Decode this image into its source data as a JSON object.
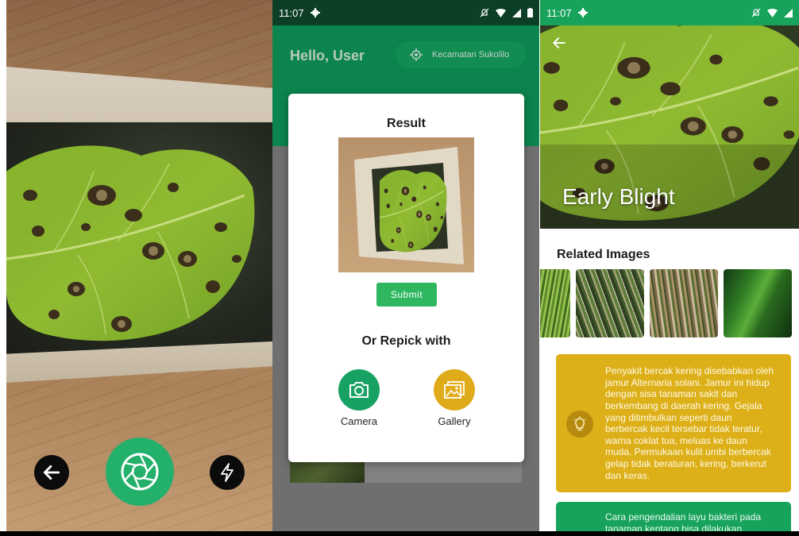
{
  "camera_screen": {
    "back_icon": "arrow-left-icon",
    "shutter_icon": "aperture-icon",
    "flash_icon": "lightning-icon"
  },
  "home_screen": {
    "status_bar": {
      "time": "11:07"
    },
    "greeting": "Hello, User",
    "location": "Kecamatan Sukolilo"
  },
  "result_dialog": {
    "title": "Result",
    "submit_label": "Submit",
    "repick_title": "Or Repick with",
    "camera_label": "Camera",
    "gallery_label": "Gallery"
  },
  "detail_screen": {
    "status_bar": {
      "time": "11:07"
    },
    "disease_name": "Early Blight",
    "related_title": "Related Images",
    "description": "Penyakit bercak kering disebabkan oleh jamur Alternaria solani. Jamur ini hidup dengan sisa tanaman sakit dan berkembang di daerah kering. Gejala yang ditimbulkan seperti daun berbercak kecil tersebar tidak teratur, warna coklat tua, meluas ke daun muda. Permukaan kulit umbi berbercak gelap tidak beraturan, kering, berkerut dan keras.",
    "control_text": "Cara pengendalian layu bakteri pada tanaman kentang bisa dilakukan"
  },
  "colors": {
    "primary_green": "#0f9e5c",
    "dark_green": "#0c3f26",
    "accent_yellow": "#ddb01a",
    "submit_green": "#2fb760"
  }
}
